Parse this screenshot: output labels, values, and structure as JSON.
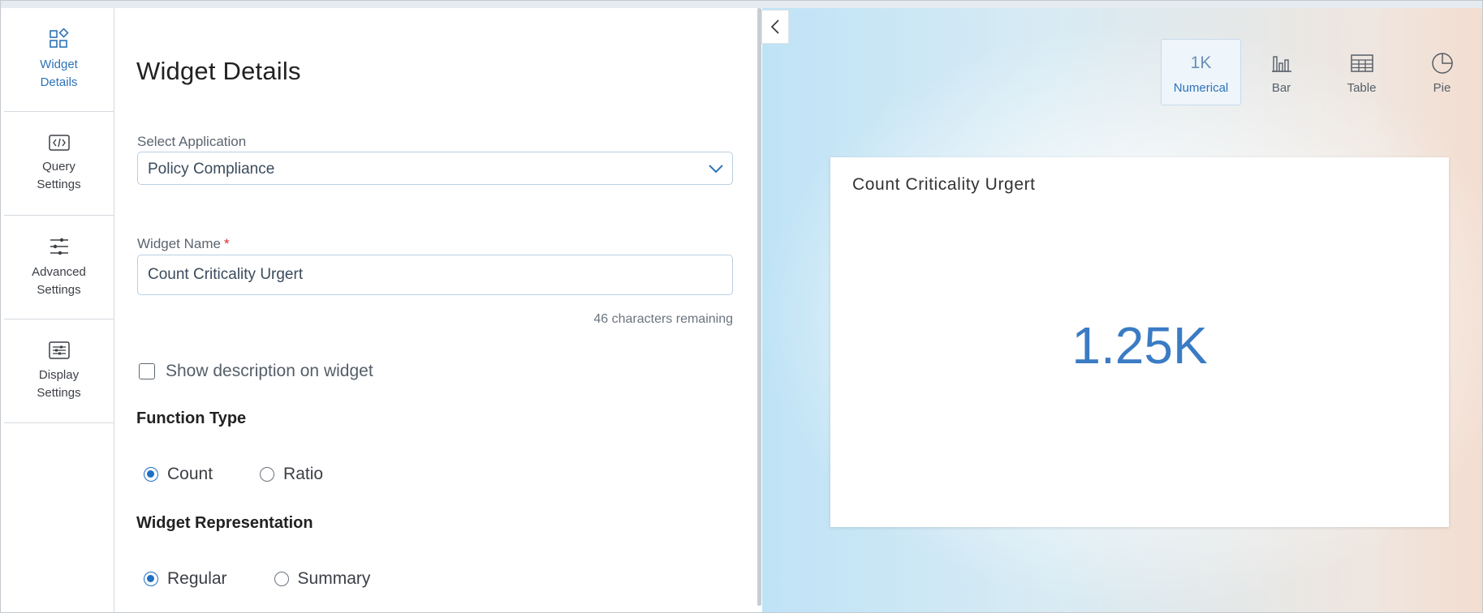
{
  "nav": {
    "items": [
      {
        "label1": "Widget",
        "label2": "Details",
        "icon": "widget-details-icon",
        "active": true
      },
      {
        "label1": "Query",
        "label2": "Settings",
        "icon": "code-icon"
      },
      {
        "label1": "Advanced",
        "label2": "Settings",
        "icon": "sliders-icon"
      },
      {
        "label1": "Display",
        "label2": "Settings",
        "icon": "display-settings-icon"
      }
    ]
  },
  "form": {
    "title": "Widget Details",
    "select_label": "Select Application",
    "select_value": "Policy Compliance",
    "name_label": "Widget Name",
    "name_required": "*",
    "name_value": "Count Criticality Urgert",
    "remaining": "46 characters remaining",
    "show_description": "Show description on widget",
    "function_type": {
      "title": "Function Type",
      "options": [
        "Count",
        "Ratio"
      ],
      "selected": "Count"
    },
    "representation": {
      "title": "Widget Representation",
      "options": [
        "Regular",
        "Summary"
      ],
      "selected": "Regular"
    }
  },
  "preview": {
    "tabs": [
      {
        "label": "Numerical",
        "icon_text": "1K",
        "active": true
      },
      {
        "label": "Bar",
        "icon": "bar-chart-icon"
      },
      {
        "label": "Table",
        "icon": "table-icon"
      },
      {
        "label": "Pie",
        "icon": "pie-chart-icon"
      }
    ],
    "card": {
      "title": "Count Criticality Urgert",
      "value": "1.25K"
    }
  },
  "colors": {
    "accent": "#2e73b8",
    "value": "#3a7bc4",
    "required": "#d32f2f"
  }
}
